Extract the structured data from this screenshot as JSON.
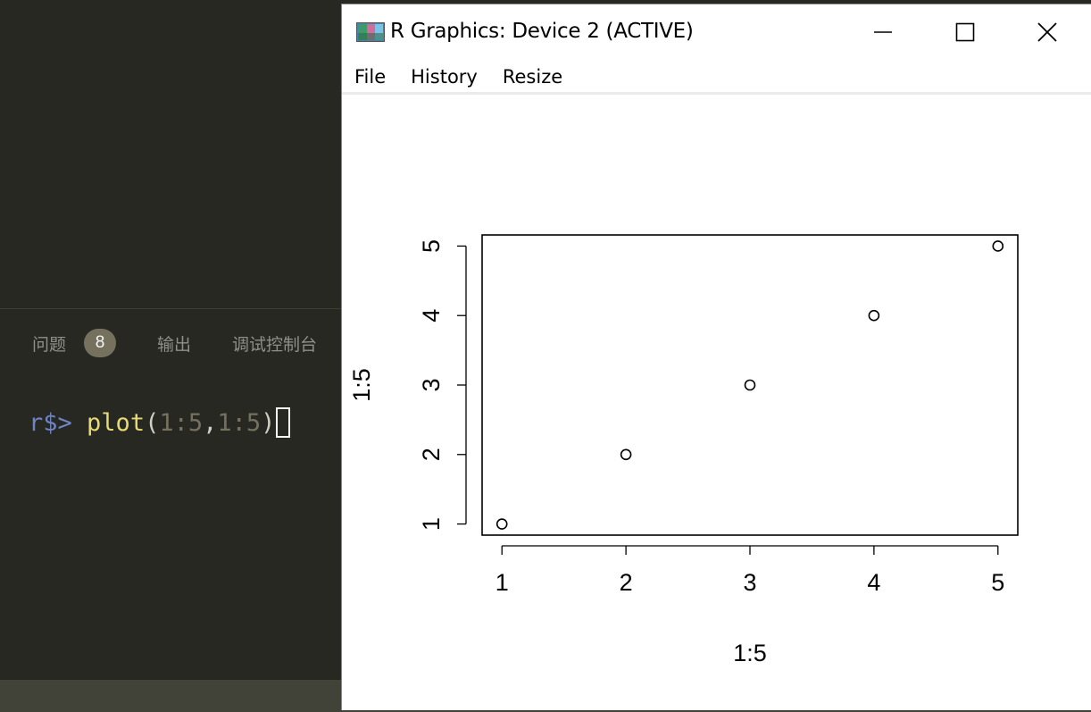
{
  "panel": {
    "tabs": [
      {
        "label": "问题",
        "badge": "8"
      },
      {
        "label": "输出"
      },
      {
        "label": "调试控制台"
      }
    ]
  },
  "terminal": {
    "prompt": "r$>",
    "command": "plot",
    "open_paren": "(",
    "arg1": "1:5",
    "comma": ",",
    "arg2": "1:5",
    "close_paren": ")"
  },
  "rwindow": {
    "title": "R Graphics: Device 2 (ACTIVE)",
    "menu": [
      "File",
      "History",
      "Resize"
    ],
    "colors": {
      "title_bg": "#ffffff",
      "plot_bg": "#ffffff"
    }
  },
  "chart_data": {
    "type": "scatter",
    "title": "",
    "xlabel": "1:5",
    "ylabel": "1:5",
    "x": [
      1,
      2,
      3,
      4,
      5
    ],
    "y": [
      1,
      2,
      3,
      4,
      5
    ],
    "xticks": [
      "1",
      "2",
      "3",
      "4",
      "5"
    ],
    "yticks": [
      "1",
      "2",
      "3",
      "4",
      "5"
    ],
    "xlim": [
      0.84,
      5.16
    ],
    "ylim": [
      0.84,
      5.16
    ],
    "grid": false,
    "marker": "open-circle"
  }
}
